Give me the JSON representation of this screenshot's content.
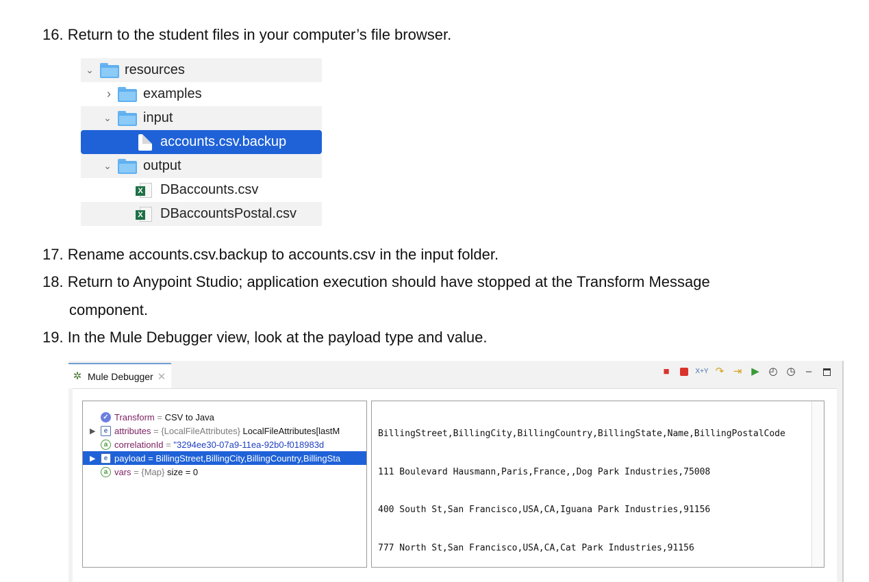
{
  "steps": [
    {
      "num": "16.",
      "text": "Return to the student files in your computer’s file browser."
    },
    {
      "num": "17.",
      "text": "Rename accounts.csv.backup to accounts.csv in the input folder."
    },
    {
      "num": "18.",
      "text": "Return to Anypoint Studio; application execution should have stopped at the Transform Message",
      "cont": "component."
    },
    {
      "num": "19.",
      "text": "In the Mule Debugger view, look at the payload type and value."
    }
  ],
  "file_tree": [
    {
      "label": "resources",
      "kind": "folder",
      "expanded": true,
      "chevron": "⌄"
    },
    {
      "label": "examples",
      "kind": "folder",
      "expanded": false,
      "chevron": "›"
    },
    {
      "label": "input",
      "kind": "folder",
      "expanded": true,
      "chevron": "⌄"
    },
    {
      "label": "accounts.csv.backup",
      "kind": "file",
      "selected": true
    },
    {
      "label": "output",
      "kind": "folder",
      "expanded": true,
      "chevron": "⌄"
    },
    {
      "label": "DBaccounts.csv",
      "kind": "spreadsheet",
      "icon_letter": "X"
    },
    {
      "label": "DBaccountsPostal.csv",
      "kind": "spreadsheet",
      "icon_letter": "X"
    }
  ],
  "debugger": {
    "tab_label": "Mule Debugger",
    "tab_close": "✕",
    "variables": [
      {
        "expand": "",
        "icon": "v",
        "icon_letter": "✓",
        "name": "Transform",
        "eq": " = ",
        "type": "",
        "value": "CSV to Java",
        "value_style": "plain"
      },
      {
        "expand": "▶",
        "icon": "e",
        "icon_letter": "e",
        "name": "attributes",
        "eq": " = ",
        "type": "{LocalFileAttributes} ",
        "value": "LocalFileAttributes[lastM",
        "value_style": "plain"
      },
      {
        "expand": "",
        "icon": "a",
        "icon_letter": "a",
        "name": "correlationId",
        "eq": " = ",
        "type": "",
        "value": "\"3294ee30-07a9-11ea-92b0-f018983d",
        "value_style": "string"
      },
      {
        "expand": "▶",
        "icon": "e",
        "icon_letter": "e",
        "name": "payload",
        "eq": " = ",
        "type": "",
        "value": "BillingStreet,BillingCity,BillingCountry,BillingSta",
        "value_style": "plain",
        "selected": true
      },
      {
        "expand": "",
        "icon": "a",
        "icon_letter": "a",
        "name": "vars",
        "eq": " = ",
        "type": "{Map} ",
        "value": "size = 0",
        "value_style": "plain"
      }
    ],
    "payload_value": [
      "BillingStreet,BillingCity,BillingCountry,BillingState,Name,BillingPostalCode",
      "111 Boulevard Hausmann,Paris,France,,Dog Park Industries,75008",
      "400 South St,San Francisco,USA,CA,Iguana Park Industries,91156",
      "777 North St,San Francisco,USA,CA,Cat Park Industries,91156"
    ],
    "toolbar_icons": [
      "disconnect-icon",
      "stop-icon",
      "evaluate-expression-icon",
      "step-over-icon",
      "step-into-icon",
      "resume-icon",
      "clock-icon",
      "clock-alert-icon",
      "minimize-icon",
      "maximize-icon"
    ],
    "colors": {
      "selection": "#1f62d8",
      "variable_name": "#7a1f5f",
      "string_value": "#1d3fbf"
    }
  }
}
